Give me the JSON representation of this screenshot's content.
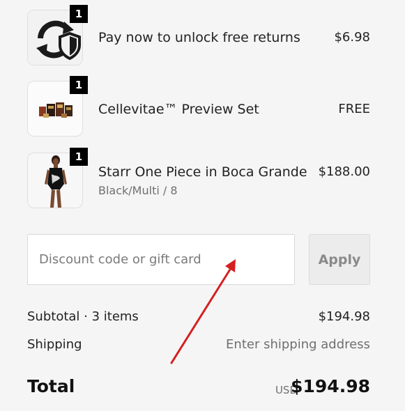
{
  "line_items": [
    {
      "name": "Pay now to unlock free returns",
      "variant": "",
      "price": "$6.98",
      "quantity": "1",
      "image": "returns-shield-icon"
    },
    {
      "name": "Cellevitae™ Preview Set",
      "variant": "",
      "price": "FREE",
      "quantity": "1",
      "image": "product-boxes"
    },
    {
      "name": "Starr One Piece in Boca Grande",
      "variant": "Black/Multi / 8",
      "price": "$188.00",
      "quantity": "1",
      "image": "swimsuit-model"
    }
  ],
  "discount": {
    "placeholder": "Discount code or gift card",
    "value": "",
    "apply_label": "Apply"
  },
  "summary": {
    "subtotal_label": "Subtotal · 3 items",
    "subtotal_value": "$194.98",
    "shipping_label": "Shipping",
    "shipping_value": "Enter shipping address",
    "total_label": "Total",
    "total_currency": "USD",
    "total_value": "$194.98"
  },
  "annotation": {
    "arrow_color": "#d42020"
  }
}
